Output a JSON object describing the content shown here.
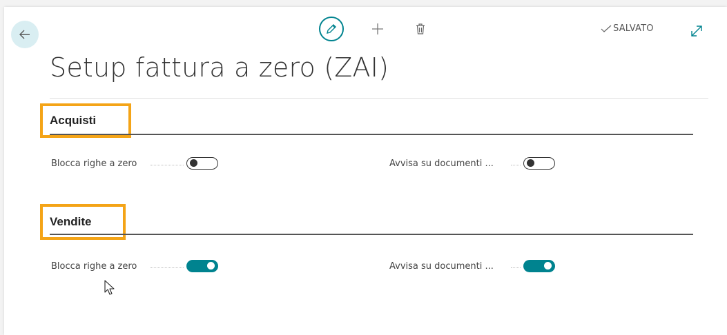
{
  "toolbar": {
    "status_label": "SALVATO"
  },
  "page": {
    "title": "Setup fattura a zero (ZAI)"
  },
  "sections": [
    {
      "title": "Acquisti",
      "fields": [
        {
          "label": "Blocca righe a zero",
          "enabled": false
        },
        {
          "label": "Avvisa su documenti ...",
          "enabled": false
        }
      ]
    },
    {
      "title": "Vendite",
      "fields": [
        {
          "label": "Blocca righe a zero",
          "enabled": true
        },
        {
          "label": "Avvisa su documenti ...",
          "enabled": true
        }
      ]
    }
  ],
  "colors": {
    "accent": "#00838f",
    "highlight": "#f4a417"
  },
  "icons": [
    "back-arrow-icon",
    "pencil-icon",
    "plus-icon",
    "trash-icon",
    "checkmark-icon",
    "expand-icon",
    "mouse-cursor-icon"
  ]
}
